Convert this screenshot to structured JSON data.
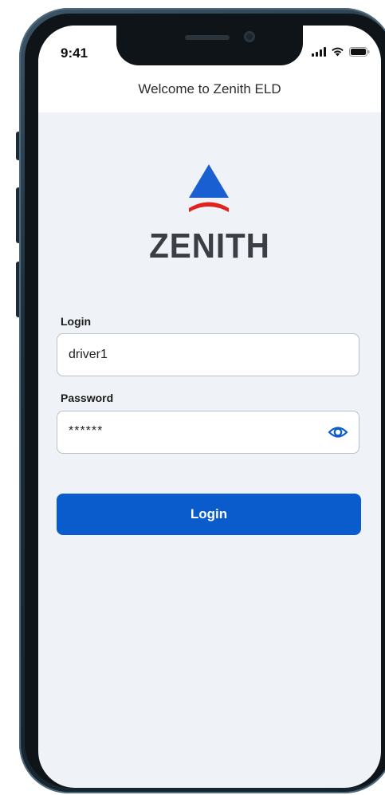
{
  "status_bar": {
    "time": "9:41"
  },
  "header": {
    "title": "Welcome to Zenith ELD"
  },
  "logo": {
    "wordmark": "ZENITH",
    "colors": {
      "primary": "#1a5fd1",
      "accent": "#e0231c",
      "text": "#3a3f46"
    }
  },
  "form": {
    "login_label": "Login",
    "login_value": "driver1",
    "password_label": "Password",
    "password_value": "******",
    "password_toggle_icon": "eye-icon",
    "submit_label": "Login"
  },
  "colors": {
    "background": "#eff2f7",
    "button": "#0a5ccc",
    "header": "#ffffff"
  }
}
